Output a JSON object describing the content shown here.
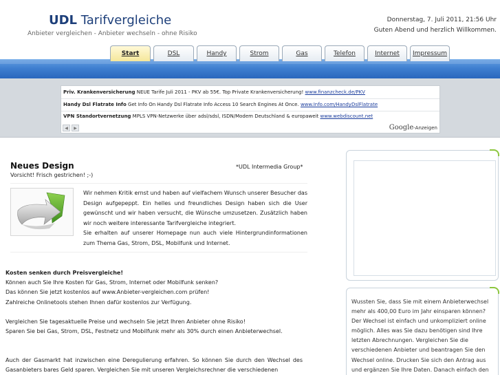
{
  "header": {
    "logo_bold": "UDL",
    "logo_rest": " Tarifvergleiche",
    "tagline": "Anbieter vergleichen - Anbieter wechseln - ohne Risiko",
    "date": "Donnerstag, 7. Juli 2011, 21:56 Uhr",
    "greeting": "Guten Abend und herzlich Willkommen."
  },
  "nav": {
    "tabs": [
      {
        "label": "Start"
      },
      {
        "label": "DSL"
      },
      {
        "label": "Handy"
      },
      {
        "label": "Strom"
      },
      {
        "label": "Gas"
      },
      {
        "label": "Telefon"
      },
      {
        "label": "Internet"
      },
      {
        "label": "Impressum"
      }
    ]
  },
  "ads": {
    "items": [
      {
        "title": "Priv. Krankenversicherung",
        "text": " NEUE Tarife Juli 2011 - PKV ab 55€. Top Private Krankenversicherung! ",
        "url": "www.finanzcheck.de/PKV"
      },
      {
        "title": "Handy Dsl Flatrate Info",
        "text": " Get Info On Handy Dsl Flatrate Info Access 10 Search Engines At Once. ",
        "url": "www.Info.com/HandyDslFlatrate"
      },
      {
        "title": "VPN Standortvernetzung",
        "text": " MPLS VPN-Netzwerke über adsl/sdsl, ISDN/Modem Deutschland & europaweit ",
        "url": "www.webdiscount.net"
      }
    ],
    "google_word": "Google",
    "google_suffix": "-Anzeigen",
    "prev_arrow": "◀",
    "next_arrow": "▶"
  },
  "article": {
    "title": "Neues Design",
    "subtitle": "Vorsicht! Frisch gestrichen! ;-)",
    "author": "*UDL Intermedia Group*",
    "intro_p1": "Wir nehmen Kritik ernst und haben auf vielfachem Wunsch unserer Besucher das Design aufgepeppt. Ein helles und freundliches Design haben sich die User gewünscht und wir haben versucht, die Wünsche umzusetzen. Zusätzlich haben wir noch weitere interessante Tarifvergleiche integriert.",
    "intro_p2": "Sie erhalten auf unserer Homepage nun auch viele Hintergrundinformationen zum Thema Gas, Strom, DSL, Mobilfunk und Internet."
  },
  "body": {
    "heading": "Kosten senken durch Preisvergleiche!",
    "line1": "Können auch Sie Ihre Kosten für Gas, Strom, Internet oder Mobilfunk senken?",
    "line2": "Das können Sie jetzt kostenlos auf www.Anbieter-vergleichen.com prüfen!",
    "line3": "Zahlreiche Onlinetools stehen Ihnen dafür kostenlos zur Verfügung.",
    "line4": "Vergleichen Sie tagesaktuelle Preise und wechseln Sie jetzt Ihren Anbieter ohne Risiko!",
    "line5": "Sparen Sie bei Gas, Strom, DSL, Festnetz und Mobilfunk mehr als 30% durch einen Anbieterwechsel.",
    "para3": "Auch der Gasmarkt hat inzwischen eine Deregulierung erfahren. So können Sie durch den Wechsel des Gasanbieters bares Geld sparen. Vergleichen Sie mit unseren Vergleichsrechner die verschiedenen"
  },
  "sidebar": {
    "info_text": "Wussten Sie, dass Sie mit einem Anbieterwechsel mehr als 400,00 Euro im Jahr einsparen können? Der Wechsel ist einfach und unkompliziert online möglich. Alles was Sie dazu benötigen sind Ihre letzten Abrechnungen. Vergleichen Sie die verschiedenen Anbieter und beantragen Sie den Wechsel online. Drucken Sie sich den Antrag aus und ergänzen Sie Ihre Daten. Danach einfach den"
  },
  "colors": {
    "nav_band": "#3f7fd0",
    "logo": "#1d3f7a",
    "ad_background": "#d4d9de",
    "accent_green": "#8cc63e",
    "active_tab": "#f5e79a"
  }
}
